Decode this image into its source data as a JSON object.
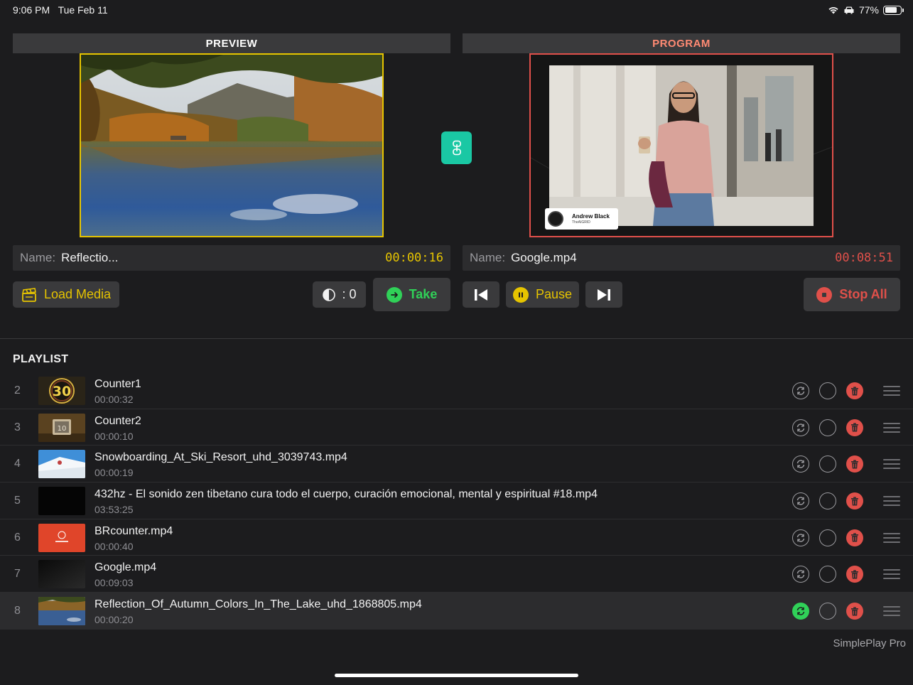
{
  "status_bar": {
    "time": "9:06 PM",
    "date": "Tue Feb 11",
    "battery": "77%",
    "battery_level": 0.77
  },
  "preview": {
    "header": "PREVIEW",
    "name_label": "Name:",
    "name_value": "Reflectio...",
    "timecode": "00:00:16",
    "border_color": "#e6c400"
  },
  "program": {
    "header": "PROGRAM",
    "name_label": "Name:",
    "name_value": "Google.mp4",
    "timecode": "00:08:51",
    "border_color": "#e0504a",
    "lower_third": {
      "name": "Andrew Black",
      "subtitle": "TheAIGRID"
    }
  },
  "controls": {
    "load_media": "Load Media",
    "mix_value": ": 0",
    "take": "Take",
    "pause": "Pause",
    "stop_all": "Stop All"
  },
  "playlist": {
    "title": "PLAYLIST",
    "items": [
      {
        "num": "2",
        "title": "Counter1",
        "duration": "00:00:32",
        "thumb": "counter-30",
        "loop_active": false,
        "selected": false
      },
      {
        "num": "3",
        "title": "Counter2",
        "duration": "00:00:10",
        "thumb": "counter-10",
        "loop_active": false,
        "selected": false
      },
      {
        "num": "4",
        "title": "Snowboarding_At_Ski_Resort_uhd_3039743.mp4",
        "duration": "00:00:19",
        "thumb": "snow",
        "loop_active": false,
        "selected": false
      },
      {
        "num": "5",
        "title": "432hz - El sonido zen tibetano cura todo el cuerpo, curación emocional, mental y espiritual #18.mp4",
        "duration": "03:53:25",
        "thumb": "black",
        "loop_active": false,
        "selected": false
      },
      {
        "num": "6",
        "title": "BRcounter.mp4",
        "duration": "00:00:40",
        "thumb": "red-counter",
        "loop_active": false,
        "selected": false
      },
      {
        "num": "7",
        "title": "Google.mp4",
        "duration": "00:09:03",
        "thumb": "dark",
        "loop_active": false,
        "selected": false
      },
      {
        "num": "8",
        "title": "Reflection_Of_Autumn_Colors_In_The_Lake_uhd_1868805.mp4",
        "duration": "00:00:20",
        "thumb": "lake",
        "loop_active": true,
        "selected": true
      }
    ]
  },
  "brand": "SimplePlay Pro",
  "colors": {
    "accent_yellow": "#e6c400",
    "accent_red": "#e0504a",
    "accent_green": "#30d158",
    "sync_teal": "#1ac8a4"
  }
}
